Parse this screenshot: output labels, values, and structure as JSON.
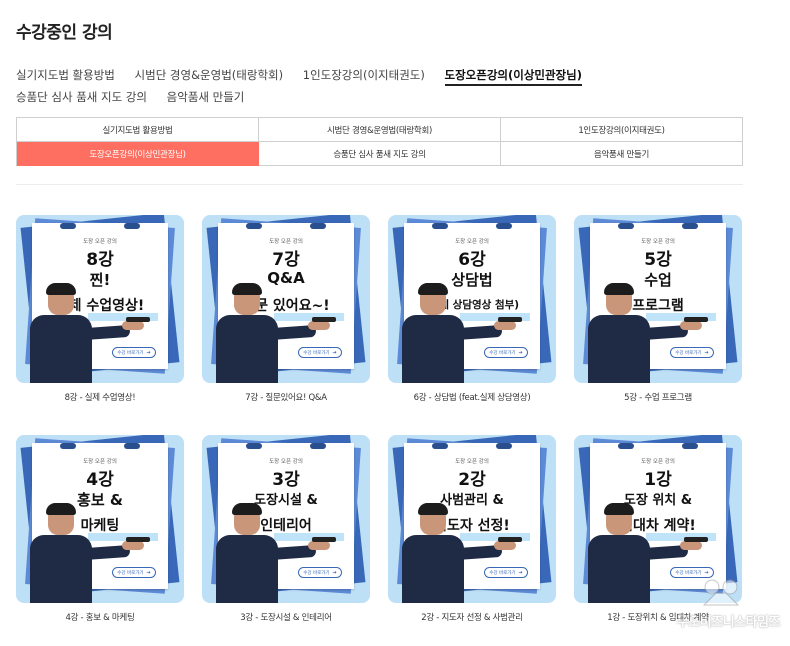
{
  "page": {
    "title": "수강중인 강의"
  },
  "tabs": [
    {
      "label": "실기지도법 활용방법",
      "active": false
    },
    {
      "label": "시범단 경영&운영법(태랑학회)",
      "active": false
    },
    {
      "label": "1인도장강의(이지태권도)",
      "active": false
    },
    {
      "label": "도장오픈강의(이상민관장님)",
      "active": true
    },
    {
      "label": "승품단 심사 품새 지도 강의",
      "active": false
    },
    {
      "label": "음악품새 만들기",
      "active": false
    }
  ],
  "grid_menu": [
    {
      "label": "실기지도법 활용방법",
      "active": false
    },
    {
      "label": "시범단 경영&운영법(태랑학회)",
      "active": false
    },
    {
      "label": "1인도장강의(이지태권도)",
      "active": false
    },
    {
      "label": "도장오픈강의(이상민관장님)",
      "active": true
    },
    {
      "label": "승품단 심사 품새 지도 강의",
      "active": false
    },
    {
      "label": "음악품새 만들기",
      "active": false
    }
  ],
  "courses": [
    {
      "num": "8강",
      "line1": "찐!",
      "line2": "실제 수업영상!",
      "caption": "8강 - 실제 수업영상!"
    },
    {
      "num": "7강",
      "line1": "Q&A",
      "line2": "질문 있어요~!",
      "caption": "7강 - 질문있어요! Q&A"
    },
    {
      "num": "6강",
      "line1": "상담법",
      "line2": "(실제 상담영상 첨부)",
      "caption": "6강 - 상담법 (feat.실제 상담영상)"
    },
    {
      "num": "5강",
      "line1": "수업",
      "line2": "프로그램",
      "caption": "5강 - 수업 프로그램"
    },
    {
      "num": "4강",
      "line1": "홍보 &",
      "line2": "마케팅",
      "caption": "4강 - 홍보 & 마케팅"
    },
    {
      "num": "3강",
      "line1": "도장시설 &",
      "line2": "인테리어",
      "caption": "3강 - 도장시설 & 인테리어"
    },
    {
      "num": "2강",
      "line1": "사범관리 &",
      "line2": "지도자 선정!",
      "caption": "2강 - 지도자 선정 & 사범관리"
    },
    {
      "num": "1강",
      "line1": "도장 위치 &",
      "line2": "임대차 계약!",
      "caption": "1강 - 도장위치 & 임대차 계약"
    }
  ],
  "thumb_badge": "도장 오픈 강의",
  "thumb_button": "수강 바로가기",
  "watermark": "무도비즈니스타임즈",
  "colors": {
    "accent": "#ff6f61",
    "thumb_bg": "#bde0f7",
    "paper_blue": "#3a68b8"
  }
}
